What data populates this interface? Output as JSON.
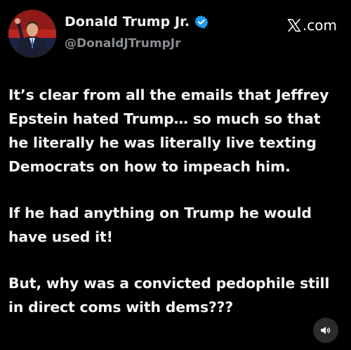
{
  "post": {
    "author": {
      "display_name": "Donald Trump Jr.",
      "handle": "@DonaldJTrumpJr",
      "verified_icon": "verified-badge-icon"
    },
    "platform": {
      "domain": ".com",
      "logo_icon": "x-logo-icon"
    },
    "paragraphs": [
      "It’s clear from all the emails that Jeffrey Epstein hated Trump… so much so that he literally he was literally live texting Democrats on how to impeach him.",
      "If he had anything on Trump he would have used it!",
      "But, why was a convicted pedophile still in direct coms with dems???"
    ],
    "media_control": {
      "icon": "speaker-icon"
    }
  },
  "colors": {
    "background": "#000000",
    "text": "#f4f4f4",
    "handle": "#8a8d91",
    "verified": "#1d9bf0",
    "avatar_backdrop": "#b9261f",
    "sound_button": "#2b2b2b"
  }
}
